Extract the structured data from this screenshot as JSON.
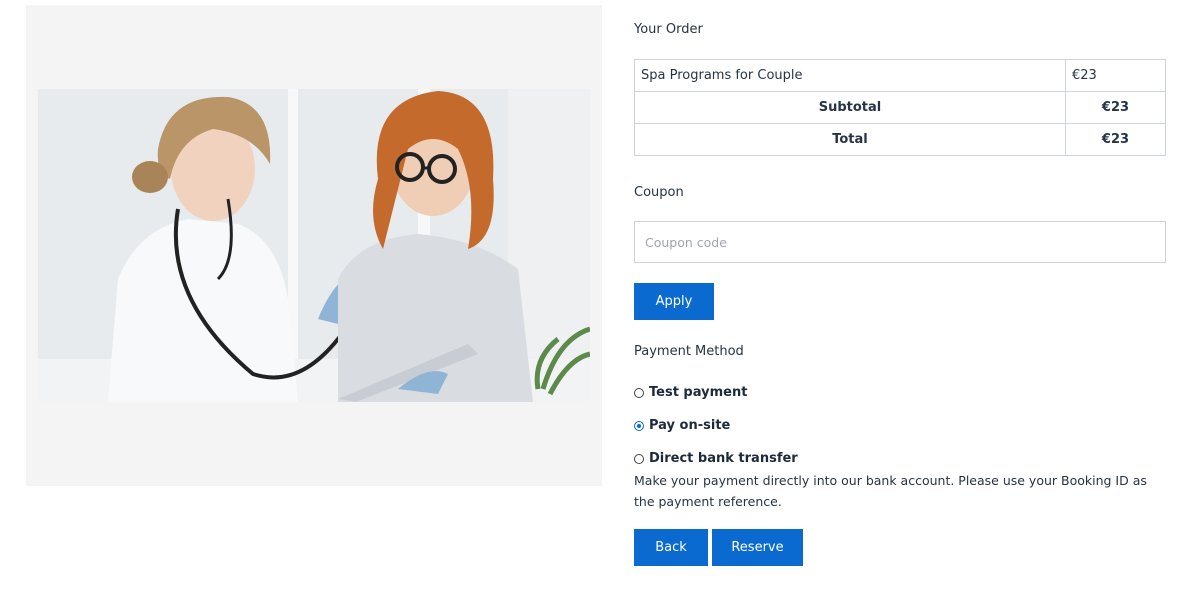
{
  "order": {
    "title": "Your Order",
    "item_name": "Spa Programs for Couple",
    "item_price": "€23",
    "subtotal_label": "Subtotal",
    "subtotal_value": "€23",
    "total_label": "Total",
    "total_value": "€23"
  },
  "coupon": {
    "label": "Coupon",
    "placeholder": "Coupon code",
    "value": "",
    "apply_label": "Apply"
  },
  "payment": {
    "label": "Payment Method",
    "options": [
      {
        "label": "Test payment",
        "selected": false
      },
      {
        "label": "Pay on-site",
        "selected": true
      },
      {
        "label": "Direct bank transfer",
        "selected": false
      }
    ],
    "bank_description": "Make your payment directly into our bank account. Please use your Booking ID as the payment reference."
  },
  "actions": {
    "back_label": "Back",
    "reserve_label": "Reserve"
  },
  "colors": {
    "accent": "#0a6ad0",
    "panel_bg": "#f4f4f4",
    "border": "#cfd4da"
  },
  "image": {
    "icon": "doctor-patient-photo"
  }
}
